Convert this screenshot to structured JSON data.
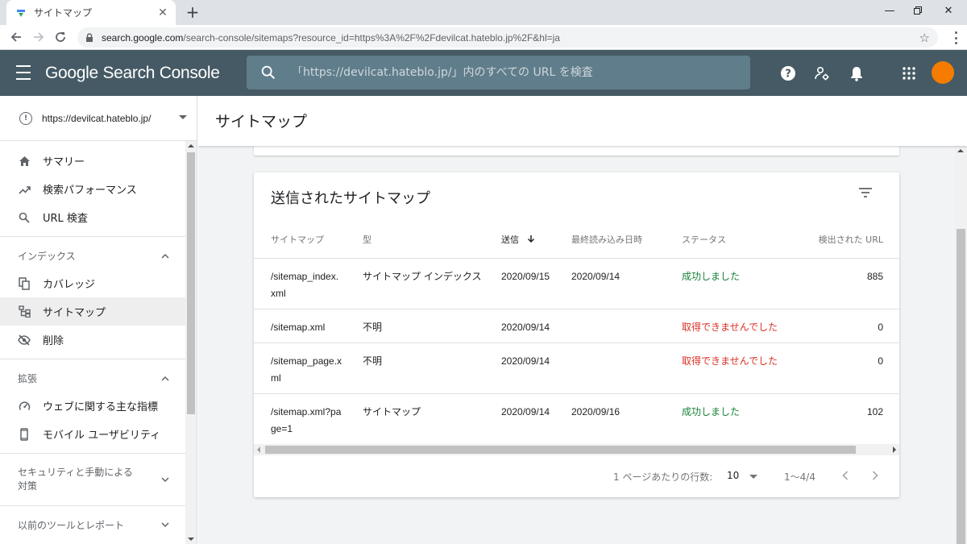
{
  "browser": {
    "tab_title": "サイトマップ",
    "new_tab_icon": "plus-icon",
    "url_host": "search.google.com",
    "url_path": "/search-console/sitemaps?resource_id=https%3A%2F%2Fdevilcat.hateblo.jp%2F&hl=ja"
  },
  "header": {
    "logo": "Google Search Console",
    "search_placeholder": "「https://devilcat.hateblo.jp/」内のすべての URL を検査",
    "accent": "#455a64",
    "avatar_color": "#f57c00"
  },
  "sidebar": {
    "property": "https://devilcat.hateblo.jp/",
    "top_items": [
      {
        "label": "サマリー",
        "icon": "home-icon"
      },
      {
        "label": "検索パフォーマンス",
        "icon": "trending-up-icon"
      },
      {
        "label": "URL 検査",
        "icon": "search-icon"
      }
    ],
    "index_section": "インデックス",
    "index_items": [
      {
        "label": "カバレッジ",
        "icon": "copy-icon"
      },
      {
        "label": "サイトマップ",
        "icon": "sitemap-icon"
      },
      {
        "label": "削除",
        "icon": "visibility-off-icon"
      }
    ],
    "enhance_section": "拡張",
    "enhance_items": [
      {
        "label": "ウェブに関する主な指標",
        "icon": "speed-icon"
      },
      {
        "label": "モバイル ユーザビリティ",
        "icon": "smartphone-icon"
      }
    ],
    "security_section_line1": "セキュリティと手動による",
    "security_section_line2": "対策",
    "legacy_section": "以前のツールとレポート"
  },
  "main": {
    "page_title": "サイトマップ",
    "card_title": "送信されたサイトマップ",
    "columns": [
      "サイトマップ",
      "型",
      "送信",
      "最終読み込み日時",
      "ステータス",
      "検出された URL"
    ],
    "rows": [
      {
        "sitemap_l1": "/sitemap_index.",
        "sitemap_l2": "xml",
        "type": "サイトマップ インデックス",
        "submitted": "2020/09/15",
        "last_read": "2020/09/14",
        "status": "成功しました",
        "urls": "885"
      },
      {
        "sitemap_l1": "/sitemap.xml",
        "sitemap_l2": "",
        "type": "不明",
        "submitted": "2020/09/14",
        "last_read": "",
        "status": "取得できませんでした",
        "urls": "0"
      },
      {
        "sitemap_l1": "/sitemap_page.x",
        "sitemap_l2": "ml",
        "type": "不明",
        "submitted": "2020/09/14",
        "last_read": "",
        "status": "取得できませんでした",
        "urls": "0"
      },
      {
        "sitemap_l1": "/sitemap.xml?pa",
        "sitemap_l2": "ge=1",
        "type": "サイトマップ",
        "submitted": "2020/09/14",
        "last_read": "2020/09/16",
        "status": "成功しました",
        "urls": "102"
      }
    ],
    "rows_per_page_label": "1 ページあたりの行数:",
    "rows_per_page": "10",
    "range": "1〜4/4",
    "success_color": "#188038",
    "error_color": "#d93025"
  }
}
